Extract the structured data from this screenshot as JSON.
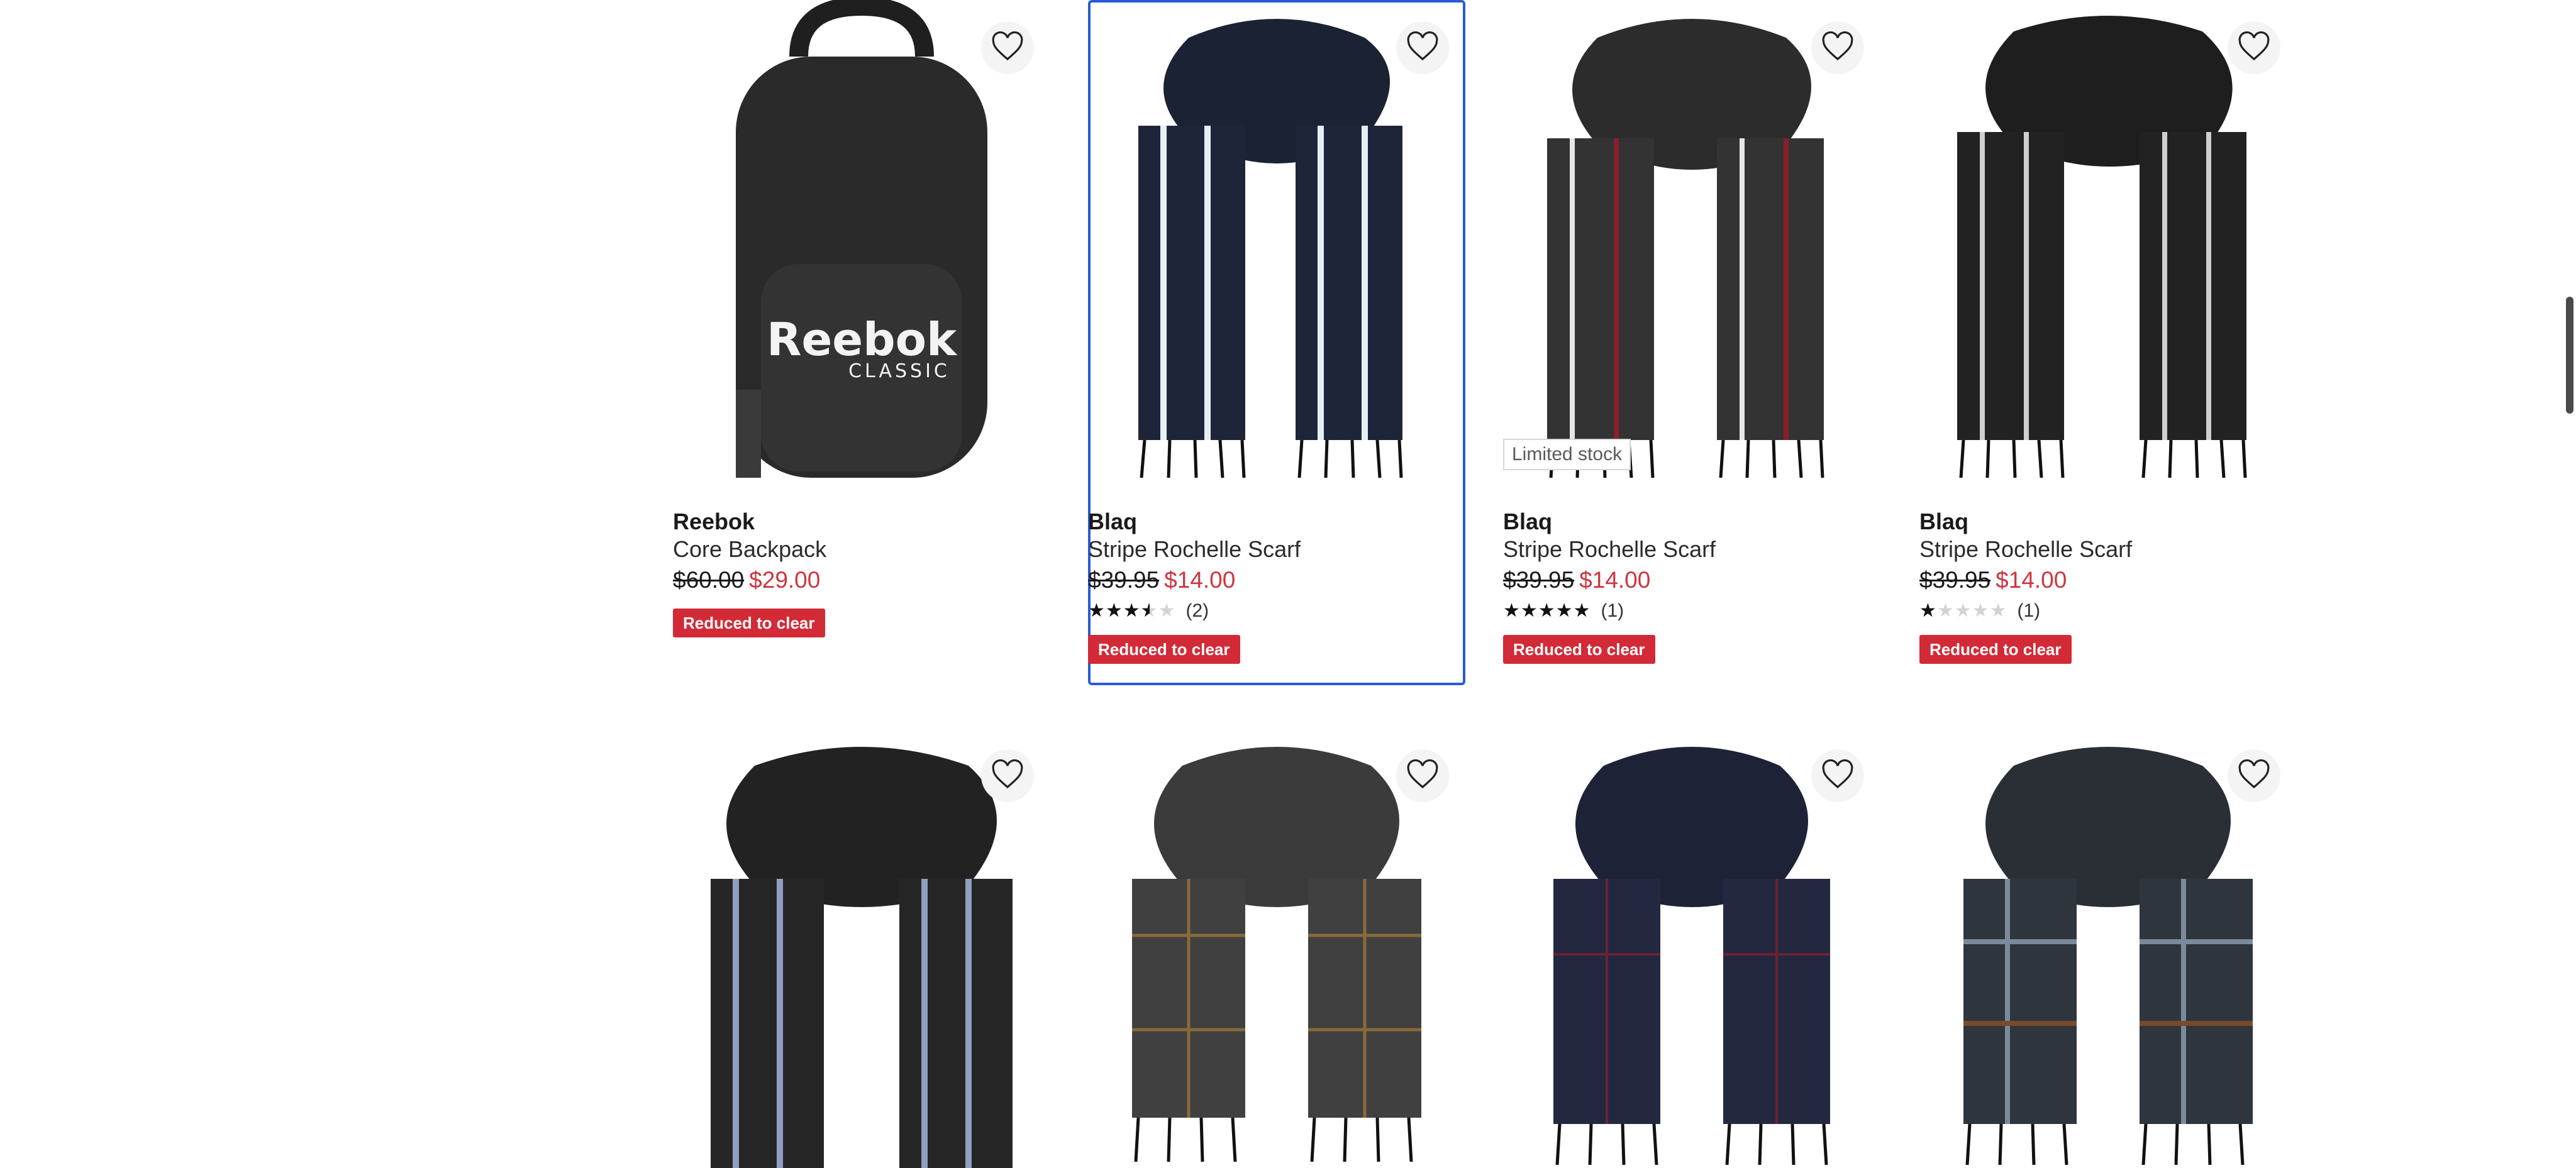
{
  "products": [
    {
      "brand": "Reebok",
      "name": "Core Backpack",
      "was": "$60.00",
      "now": "$29.00",
      "rating": null,
      "reviews": "",
      "badge": "Reduced to clear",
      "limited": "",
      "logo_text": "Reebok",
      "logo_sub": "CLASSIC"
    },
    {
      "brand": "Blaq",
      "name": "Stripe Rochelle Scarf",
      "was": "$39.95",
      "now": "$14.00",
      "rating": 0.7,
      "reviews": "(2)",
      "badge": "Reduced to clear",
      "limited": ""
    },
    {
      "brand": "Blaq",
      "name": "Stripe Rochelle Scarf",
      "was": "$39.95",
      "now": "$14.00",
      "rating": 1.0,
      "reviews": "(1)",
      "badge": "Reduced to clear",
      "limited": "Limited stock"
    },
    {
      "brand": "Blaq",
      "name": "Stripe Rochelle Scarf",
      "was": "$39.95",
      "now": "$14.00",
      "rating": 0.2,
      "reviews": "(1)",
      "badge": "Reduced to clear",
      "limited": ""
    }
  ],
  "stars_glyphs": "★★★★★",
  "colors": {
    "accent": "#2a5bd7",
    "sale": "#d0343f",
    "badge": "#d32a37"
  },
  "icons": {
    "wishlist": "heart-outline-icon"
  }
}
